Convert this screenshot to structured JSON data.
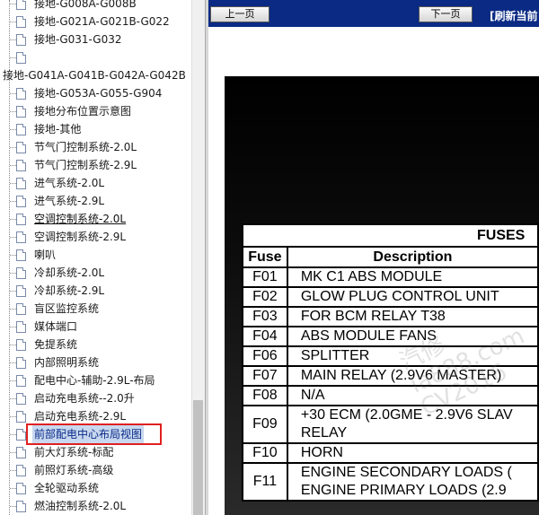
{
  "tree": {
    "items": [
      {
        "label": "接地-G008A-G008B",
        "indent": 1
      },
      {
        "label": "接地-G021A-G021B-G022",
        "indent": 1
      },
      {
        "label": "接地-G031-G032",
        "indent": 1
      },
      {
        "label": "",
        "indent": 1
      },
      {
        "label": "接地-G041A-G041B-G042A-G042B",
        "indent": 0
      },
      {
        "label": "接地-G053A-G055-G904",
        "indent": 1
      },
      {
        "label": "接地分布位置示意图",
        "indent": 1
      },
      {
        "label": "接地-其他",
        "indent": 1
      },
      {
        "label": "节气门控制系统-2.0L",
        "indent": 1
      },
      {
        "label": "节气门控制系统-2.9L",
        "indent": 1
      },
      {
        "label": "进气系统-2.0L",
        "indent": 1
      },
      {
        "label": "进气系统-2.9L",
        "indent": 1
      },
      {
        "label": "空调控制系统-2.0L",
        "indent": 1,
        "link": true
      },
      {
        "label": "空调控制系统-2.9L",
        "indent": 1
      },
      {
        "label": "喇叭",
        "indent": 1
      },
      {
        "label": "冷却系统-2.0L",
        "indent": 1
      },
      {
        "label": "冷却系统-2.9L",
        "indent": 1
      },
      {
        "label": "盲区监控系统",
        "indent": 1
      },
      {
        "label": "媒体端口",
        "indent": 1
      },
      {
        "label": "免提系统",
        "indent": 1
      },
      {
        "label": "内部照明系统",
        "indent": 1
      },
      {
        "label": "配电中心-辅助-2.9L-布局",
        "indent": 1
      },
      {
        "label": "启动充电系统--2.0升",
        "indent": 1
      },
      {
        "label": "启动充电系统-2.9L",
        "indent": 1
      },
      {
        "label": "前部配电中心布局视图",
        "indent": 1,
        "selected": true
      },
      {
        "label": "前大灯系统-标配",
        "indent": 1
      },
      {
        "label": "前照灯系统-高级",
        "indent": 1
      },
      {
        "label": "全轮驱动系统",
        "indent": 1
      },
      {
        "label": "燃油控制系统-2.0L",
        "indent": 1
      }
    ]
  },
  "nav": {
    "prev_label": "上一页",
    "next_label": "下一页",
    "refresh_label": "[刷新当前"
  },
  "fuses": {
    "title": "FUSES",
    "col_fuse": "Fuse",
    "col_desc": "Description",
    "rows": [
      {
        "fuse": "F01",
        "desc": [
          "MK C1 ABS MODULE"
        ]
      },
      {
        "fuse": "F02",
        "desc": [
          "GLOW PLUG CONTROL UNIT"
        ]
      },
      {
        "fuse": "F03",
        "desc": [
          "FOR BCM RELAY T38"
        ]
      },
      {
        "fuse": "F04",
        "desc": [
          "ABS MODULE FANS"
        ]
      },
      {
        "fuse": "F06",
        "desc": [
          "SPLITTER"
        ]
      },
      {
        "fuse": "F07",
        "desc": [
          "MAIN RELAY (2.9V6 MASTER)"
        ]
      },
      {
        "fuse": "F08",
        "desc": [
          "N/A"
        ]
      },
      {
        "fuse": "F09",
        "desc": [
          "+30 ECM (2.0GME - 2.9V6 SLAV",
          "RELAY"
        ]
      },
      {
        "fuse": "F10",
        "desc": [
          "HORN"
        ]
      },
      {
        "fuse": "F11",
        "desc": [
          "ENGINE SECONDARY LOADS (",
          "ENGINE PRIMARY LOADS (2.9"
        ]
      }
    ]
  },
  "watermark": [
    "汽修",
    "ia888.com",
    "CV2016"
  ],
  "colors": {
    "topbar": "#0a2a84",
    "selection_outline": "#e02020"
  }
}
